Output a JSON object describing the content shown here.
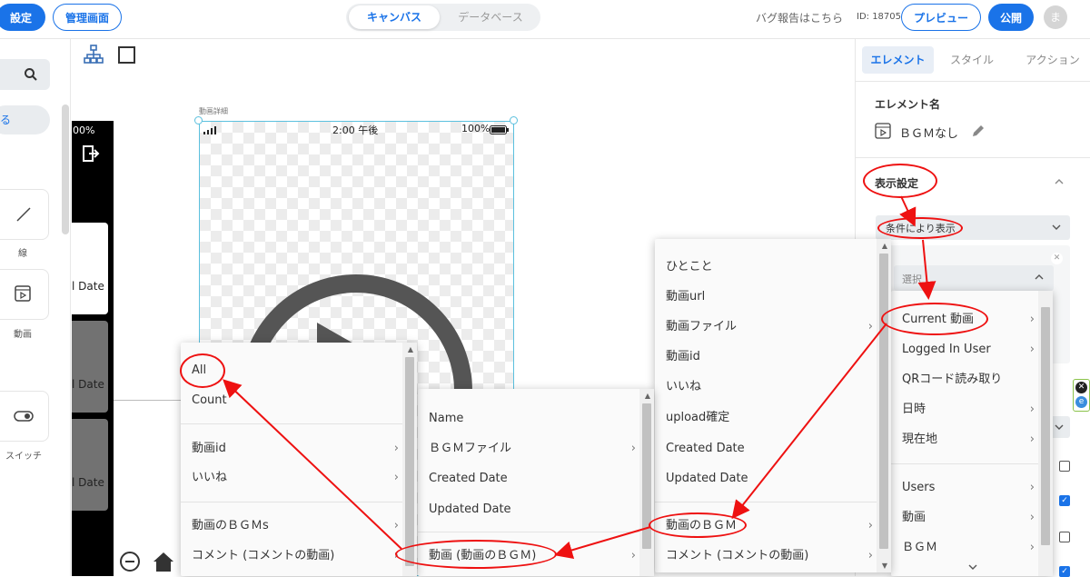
{
  "header": {
    "settings_label": "設定",
    "admin_label": "管理画面",
    "tabs": [
      "キャンバス",
      "データベース"
    ],
    "bug_report": "バグ報告はこちら",
    "app_id": "ID: 18705",
    "preview_label": "プレビュー",
    "publish_label": "公開",
    "avatar_initial": "ま"
  },
  "left_panel": {
    "partial_text": "る",
    "items": [
      {
        "label": "線",
        "icon": "line-icon"
      },
      {
        "label": "動画",
        "icon": "video-icon"
      },
      {
        "label": "スイッチ",
        "icon": "switch-icon"
      }
    ]
  },
  "back_phone": {
    "battery": "00%",
    "rows": [
      "l Date",
      "l Date",
      "l Date"
    ]
  },
  "canvas": {
    "screen_label": "動画詳細",
    "time": "2:00 午後",
    "battery": "100%"
  },
  "right_panel": {
    "tabs": [
      "エレメント",
      "スタイル",
      "アクション"
    ],
    "element_name_heading": "エレメント名",
    "element_name": "ＢＧＭなし",
    "display_settings": "表示設定",
    "display_mode": "条件により表示",
    "select_placeholder": "選択"
  },
  "menu1": {
    "items": [
      {
        "label": "All",
        "arrow": false
      },
      {
        "label": "Count",
        "arrow": false
      },
      {
        "label": "動画id",
        "arrow": true
      },
      {
        "label": "いいね",
        "arrow": true
      },
      {
        "label": "動画のＢＧＭs",
        "arrow": true
      },
      {
        "label": "コメント (コメントの動画)",
        "arrow": true
      }
    ]
  },
  "menu2": {
    "items": [
      {
        "label": "Name",
        "arrow": false
      },
      {
        "label": "ＢＧＭファイル",
        "arrow": true
      },
      {
        "label": "Created Date",
        "arrow": false
      },
      {
        "label": "Updated Date",
        "arrow": false
      },
      {
        "label": "動画 (動画のＢＧＭ)",
        "arrow": true
      }
    ]
  },
  "menu3": {
    "items": [
      {
        "label": "ひとこと",
        "arrow": false
      },
      {
        "label": "動画url",
        "arrow": false
      },
      {
        "label": "動画ファイル",
        "arrow": true
      },
      {
        "label": "動画id",
        "arrow": false
      },
      {
        "label": "いいね",
        "arrow": false
      },
      {
        "label": "upload確定",
        "arrow": false
      },
      {
        "label": "Created Date",
        "arrow": false
      },
      {
        "label": "Updated Date",
        "arrow": false
      },
      {
        "label": "動画のＢＧＭ",
        "arrow": true
      },
      {
        "label": "コメント (コメントの動画)",
        "arrow": true
      }
    ]
  },
  "menu4": {
    "items": [
      {
        "label": "Current 動画",
        "arrow": true
      },
      {
        "label": "Logged In User",
        "arrow": true
      },
      {
        "label": "QRコード読み取り",
        "arrow": false
      },
      {
        "label": "日時",
        "arrow": true
      },
      {
        "label": "現在地",
        "arrow": true
      },
      {
        "label": "Users",
        "arrow": true
      },
      {
        "label": "動画",
        "arrow": true
      },
      {
        "label": "ＢＧＭ",
        "arrow": true
      }
    ]
  },
  "colors": {
    "accent": "#1a73e8",
    "annotation": "#e11111",
    "canvas_border": "#5bc0de"
  }
}
